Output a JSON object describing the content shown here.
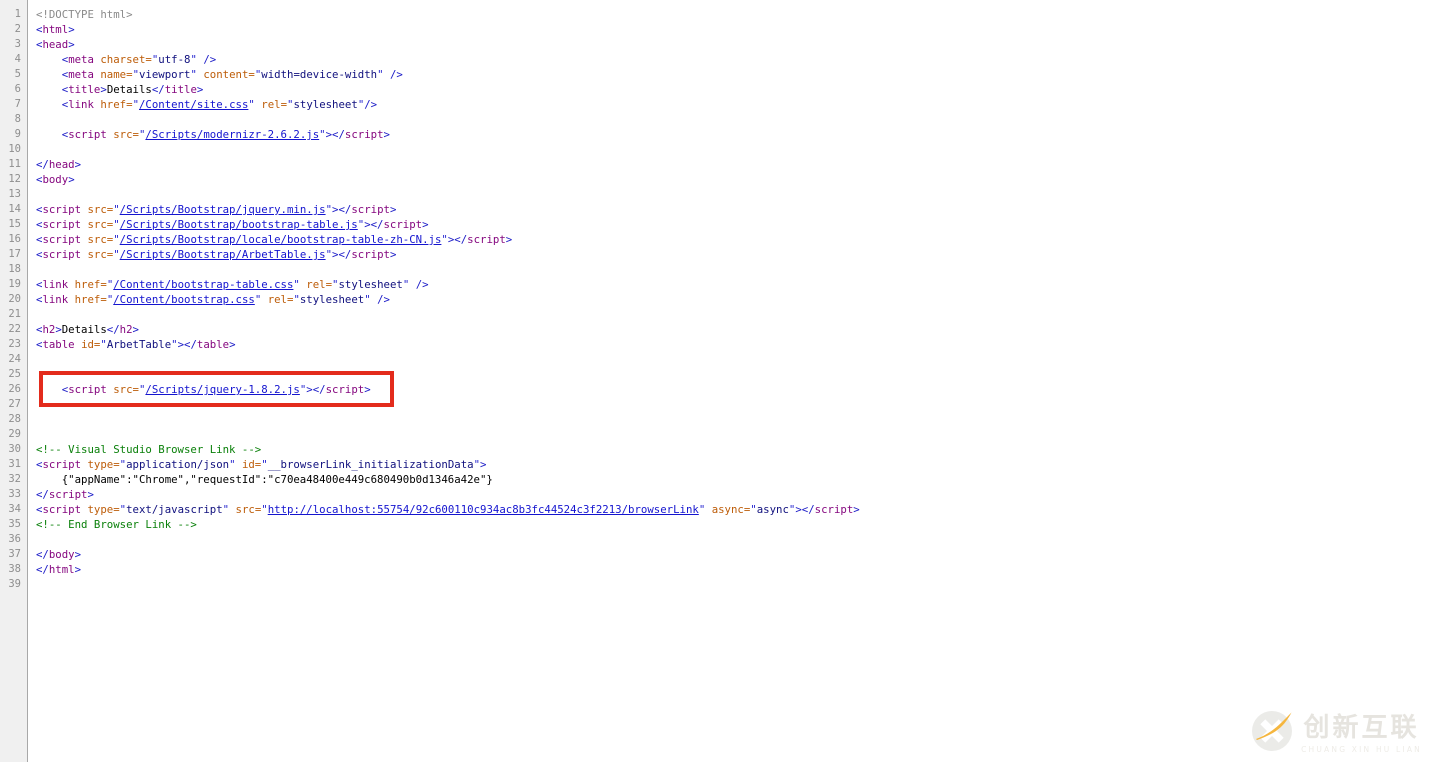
{
  "app": {
    "kind": "code-editor",
    "language": "html"
  },
  "syntax_colors": {
    "doctype": "#8a8a8a",
    "bracket": "#1b1bc7",
    "tag": "#85077f",
    "attribute": "#bd5c08",
    "quote": "#2323cf",
    "value": "#10107e",
    "link": "#1414cf",
    "text": "#000000",
    "comment": "#0a800a",
    "gutter_bg": "#f0f0f0",
    "gutter_number": "#8e8e8e",
    "highlight_box": "#e32b1c"
  },
  "token_types": {
    "g": "doctype-gray",
    "b": "bracket",
    "t": "tag-name",
    "a": "attribute-name",
    "q": "quote",
    "s": "attribute-value",
    "l": "link-url",
    "x": "plain-text",
    "c": "comment"
  },
  "code": {
    "line_count": 39,
    "highlighted_line": 26,
    "lines": [
      [
        [
          "g",
          "<!DOCTYPE html>"
        ]
      ],
      [
        [
          "b",
          "<"
        ],
        [
          "t",
          "html"
        ],
        [
          "b",
          ">"
        ]
      ],
      [
        [
          "b",
          "<"
        ],
        [
          "t",
          "head"
        ],
        [
          "b",
          ">"
        ]
      ],
      [
        [
          "x",
          "    "
        ],
        [
          "b",
          "<"
        ],
        [
          "t",
          "meta"
        ],
        [
          "x",
          " "
        ],
        [
          "a",
          "charset="
        ],
        [
          "q",
          "\""
        ],
        [
          "s",
          "utf-8"
        ],
        [
          "q",
          "\""
        ],
        [
          "x",
          " "
        ],
        [
          "b",
          "/>"
        ]
      ],
      [
        [
          "x",
          "    "
        ],
        [
          "b",
          "<"
        ],
        [
          "t",
          "meta"
        ],
        [
          "x",
          " "
        ],
        [
          "a",
          "name="
        ],
        [
          "q",
          "\""
        ],
        [
          "s",
          "viewport"
        ],
        [
          "q",
          "\""
        ],
        [
          "x",
          " "
        ],
        [
          "a",
          "content="
        ],
        [
          "q",
          "\""
        ],
        [
          "s",
          "width=device-width"
        ],
        [
          "q",
          "\""
        ],
        [
          "x",
          " "
        ],
        [
          "b",
          "/>"
        ]
      ],
      [
        [
          "x",
          "    "
        ],
        [
          "b",
          "<"
        ],
        [
          "t",
          "title"
        ],
        [
          "b",
          ">"
        ],
        [
          "x",
          "Details"
        ],
        [
          "b",
          "</"
        ],
        [
          "t",
          "title"
        ],
        [
          "b",
          ">"
        ]
      ],
      [
        [
          "x",
          "    "
        ],
        [
          "b",
          "<"
        ],
        [
          "t",
          "link"
        ],
        [
          "x",
          " "
        ],
        [
          "a",
          "href="
        ],
        [
          "q",
          "\""
        ],
        [
          "l",
          "/Content/site.css"
        ],
        [
          "q",
          "\""
        ],
        [
          "x",
          " "
        ],
        [
          "a",
          "rel="
        ],
        [
          "q",
          "\""
        ],
        [
          "s",
          "stylesheet"
        ],
        [
          "q",
          "\""
        ],
        [
          "b",
          "/>"
        ]
      ],
      [],
      [
        [
          "x",
          "    "
        ],
        [
          "b",
          "<"
        ],
        [
          "t",
          "script"
        ],
        [
          "x",
          " "
        ],
        [
          "a",
          "src="
        ],
        [
          "q",
          "\""
        ],
        [
          "l",
          "/Scripts/modernizr-2.6.2.js"
        ],
        [
          "q",
          "\""
        ],
        [
          "b",
          "></"
        ],
        [
          "t",
          "script"
        ],
        [
          "b",
          ">"
        ]
      ],
      [],
      [
        [
          "b",
          "</"
        ],
        [
          "t",
          "head"
        ],
        [
          "b",
          ">"
        ]
      ],
      [
        [
          "b",
          "<"
        ],
        [
          "t",
          "body"
        ],
        [
          "b",
          ">"
        ]
      ],
      [],
      [
        [
          "b",
          "<"
        ],
        [
          "t",
          "script"
        ],
        [
          "x",
          " "
        ],
        [
          "a",
          "src="
        ],
        [
          "q",
          "\""
        ],
        [
          "l",
          "/Scripts/Bootstrap/jquery.min.js"
        ],
        [
          "q",
          "\""
        ],
        [
          "b",
          "></"
        ],
        [
          "t",
          "script"
        ],
        [
          "b",
          ">"
        ]
      ],
      [
        [
          "b",
          "<"
        ],
        [
          "t",
          "script"
        ],
        [
          "x",
          " "
        ],
        [
          "a",
          "src="
        ],
        [
          "q",
          "\""
        ],
        [
          "l",
          "/Scripts/Bootstrap/bootstrap-table.js"
        ],
        [
          "q",
          "\""
        ],
        [
          "b",
          "></"
        ],
        [
          "t",
          "script"
        ],
        [
          "b",
          ">"
        ]
      ],
      [
        [
          "b",
          "<"
        ],
        [
          "t",
          "script"
        ],
        [
          "x",
          " "
        ],
        [
          "a",
          "src="
        ],
        [
          "q",
          "\""
        ],
        [
          "l",
          "/Scripts/Bootstrap/locale/bootstrap-table-zh-CN.js"
        ],
        [
          "q",
          "\""
        ],
        [
          "b",
          "></"
        ],
        [
          "t",
          "script"
        ],
        [
          "b",
          ">"
        ]
      ],
      [
        [
          "b",
          "<"
        ],
        [
          "t",
          "script"
        ],
        [
          "x",
          " "
        ],
        [
          "a",
          "src="
        ],
        [
          "q",
          "\""
        ],
        [
          "l",
          "/Scripts/Bootstrap/ArbetTable.js"
        ],
        [
          "q",
          "\""
        ],
        [
          "b",
          "></"
        ],
        [
          "t",
          "script"
        ],
        [
          "b",
          ">"
        ]
      ],
      [],
      [
        [
          "b",
          "<"
        ],
        [
          "t",
          "link"
        ],
        [
          "x",
          " "
        ],
        [
          "a",
          "href="
        ],
        [
          "q",
          "\""
        ],
        [
          "l",
          "/Content/bootstrap-table.css"
        ],
        [
          "q",
          "\""
        ],
        [
          "x",
          " "
        ],
        [
          "a",
          "rel="
        ],
        [
          "q",
          "\""
        ],
        [
          "s",
          "stylesheet"
        ],
        [
          "q",
          "\""
        ],
        [
          "x",
          " "
        ],
        [
          "b",
          "/>"
        ]
      ],
      [
        [
          "b",
          "<"
        ],
        [
          "t",
          "link"
        ],
        [
          "x",
          " "
        ],
        [
          "a",
          "href="
        ],
        [
          "q",
          "\""
        ],
        [
          "l",
          "/Content/bootstrap.css"
        ],
        [
          "q",
          "\""
        ],
        [
          "x",
          " "
        ],
        [
          "a",
          "rel="
        ],
        [
          "q",
          "\""
        ],
        [
          "s",
          "stylesheet"
        ],
        [
          "q",
          "\""
        ],
        [
          "x",
          " "
        ],
        [
          "b",
          "/>"
        ]
      ],
      [],
      [
        [
          "b",
          "<"
        ],
        [
          "t",
          "h2"
        ],
        [
          "b",
          ">"
        ],
        [
          "x",
          "Details"
        ],
        [
          "b",
          "</"
        ],
        [
          "t",
          "h2"
        ],
        [
          "b",
          ">"
        ]
      ],
      [
        [
          "b",
          "<"
        ],
        [
          "t",
          "table"
        ],
        [
          "x",
          " "
        ],
        [
          "a",
          "id="
        ],
        [
          "q",
          "\""
        ],
        [
          "s",
          "ArbetTable"
        ],
        [
          "q",
          "\""
        ],
        [
          "b",
          "></"
        ],
        [
          "t",
          "table"
        ],
        [
          "b",
          ">"
        ]
      ],
      [],
      [],
      [
        [
          "x",
          "    "
        ],
        [
          "b",
          "<"
        ],
        [
          "t",
          "script"
        ],
        [
          "x",
          " "
        ],
        [
          "a",
          "src="
        ],
        [
          "q",
          "\""
        ],
        [
          "l",
          "/Scripts/jquery-1.8.2.js"
        ],
        [
          "q",
          "\""
        ],
        [
          "b",
          "></"
        ],
        [
          "t",
          "script"
        ],
        [
          "b",
          ">"
        ]
      ],
      [],
      [],
      [],
      [
        [
          "c",
          "<!-- Visual Studio Browser Link -->"
        ]
      ],
      [
        [
          "b",
          "<"
        ],
        [
          "t",
          "script"
        ],
        [
          "x",
          " "
        ],
        [
          "a",
          "type="
        ],
        [
          "q",
          "\""
        ],
        [
          "s",
          "application/json"
        ],
        [
          "q",
          "\""
        ],
        [
          "x",
          " "
        ],
        [
          "a",
          "id="
        ],
        [
          "q",
          "\""
        ],
        [
          "s",
          "__browserLink_initializationData"
        ],
        [
          "q",
          "\""
        ],
        [
          "b",
          ">"
        ]
      ],
      [
        [
          "x",
          "    {\"appName\":\"Chrome\",\"requestId\":\"c70ea48400e449c680490b0d1346a42e\"}"
        ]
      ],
      [
        [
          "b",
          "</"
        ],
        [
          "t",
          "script"
        ],
        [
          "b",
          ">"
        ]
      ],
      [
        [
          "b",
          "<"
        ],
        [
          "t",
          "script"
        ],
        [
          "x",
          " "
        ],
        [
          "a",
          "type="
        ],
        [
          "q",
          "\""
        ],
        [
          "s",
          "text/javascript"
        ],
        [
          "q",
          "\""
        ],
        [
          "x",
          " "
        ],
        [
          "a",
          "src="
        ],
        [
          "q",
          "\""
        ],
        [
          "l",
          "http://localhost:55754/92c600110c934ac8b3fc44524c3f2213/browserLink"
        ],
        [
          "q",
          "\""
        ],
        [
          "x",
          " "
        ],
        [
          "a",
          "async="
        ],
        [
          "q",
          "\""
        ],
        [
          "s",
          "async"
        ],
        [
          "q",
          "\""
        ],
        [
          "b",
          "></"
        ],
        [
          "t",
          "script"
        ],
        [
          "b",
          ">"
        ]
      ],
      [
        [
          "c",
          "<!-- End Browser Link -->"
        ]
      ],
      [],
      [
        [
          "b",
          "</"
        ],
        [
          "t",
          "body"
        ],
        [
          "b",
          ">"
        ]
      ],
      [
        [
          "b",
          "</"
        ],
        [
          "t",
          "html"
        ],
        [
          "b",
          ">"
        ]
      ],
      []
    ]
  },
  "watermark": {
    "logo_icon": "x-swoosh-logo-icon",
    "cn_text": "创新互联",
    "en_text": "CHUANG XIN HU LIAN",
    "accent_color": "#f5b63e"
  }
}
